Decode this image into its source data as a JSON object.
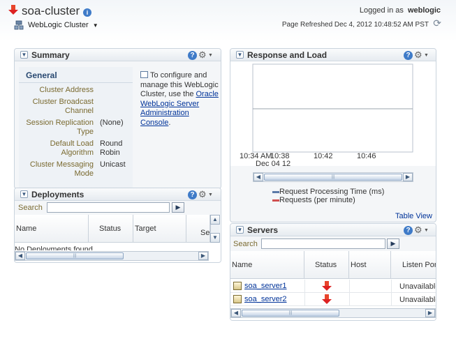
{
  "header": {
    "title": "soa-cluster",
    "target_menu": "WebLogic Cluster",
    "logged_in_label": "Logged in as",
    "username": "weblogic",
    "refresh_text": "Page Refreshed Dec 4, 2012 10:48:52 AM PST"
  },
  "summary": {
    "title": "Summary",
    "tab": "General",
    "fields": [
      {
        "label": "Cluster Address",
        "value": ""
      },
      {
        "label": "Cluster Broadcast Channel",
        "value": ""
      },
      {
        "label": "Session Replication Type",
        "value": "(None)"
      },
      {
        "label": "Default Load Algorithm",
        "value": "Round Robin"
      },
      {
        "label": "Cluster Messaging Mode",
        "value": "Unicast"
      }
    ],
    "info_pre": "To configure and manage this WebLogic Cluster, use the ",
    "info_link": "Oracle WebLogic Server Administration Console",
    "info_post": "."
  },
  "deployments": {
    "title": "Deployments",
    "search_label": "Search",
    "columns": [
      "Name",
      "Status",
      "Target",
      "Se"
    ],
    "empty_text": "No Deployments found."
  },
  "response": {
    "title": "Response and Load",
    "table_view": "Table View",
    "legend": [
      {
        "name": "Request Processing Time (ms)",
        "color": "#5b7aa8"
      },
      {
        "name": "Requests (per minute)",
        "color": "#d05050"
      }
    ]
  },
  "chart_data": {
    "type": "line",
    "x": [
      "10:34 AM",
      "10:38",
      "10:42",
      "10:46"
    ],
    "x_sublabel": "Dec 04 12",
    "series": [
      {
        "name": "Request Processing Time (ms)",
        "values": []
      },
      {
        "name": "Requests (per minute)",
        "values": []
      }
    ],
    "title": "",
    "grid": true,
    "legend_position": "bottom"
  },
  "servers": {
    "title": "Servers",
    "search_label": "Search",
    "columns": [
      "Name",
      "Status",
      "Host",
      "Listen Por"
    ],
    "rows": [
      {
        "name": "soa_server1",
        "status": "down",
        "host": "",
        "listen": "Unavailable"
      },
      {
        "name": "soa_server2",
        "status": "down",
        "host": "",
        "listen": "Unavailable"
      }
    ]
  }
}
